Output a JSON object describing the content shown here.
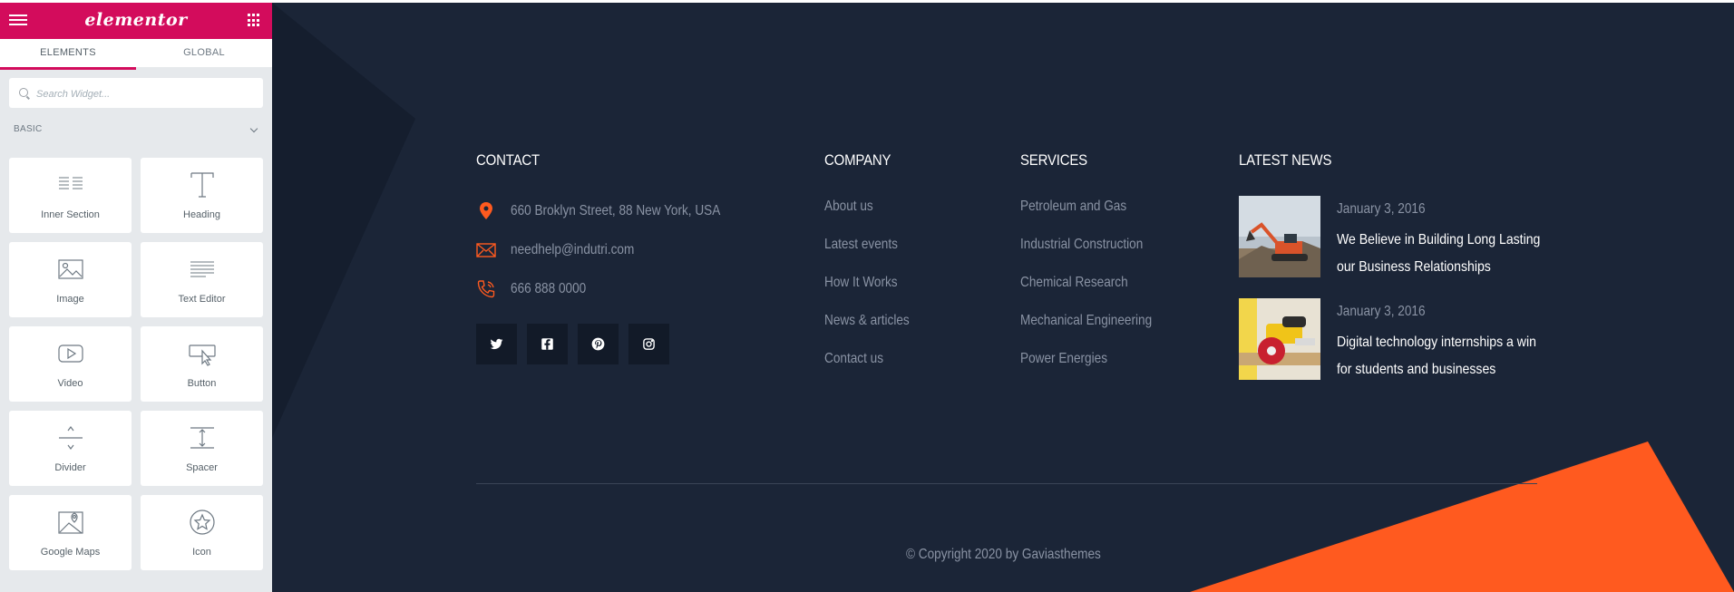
{
  "editor": {
    "brand": "elementor",
    "tabs": [
      {
        "label": "ELEMENTS"
      },
      {
        "label": "GLOBAL"
      }
    ],
    "search": {
      "placeholder": "Search Widget..."
    },
    "category": "BASIC",
    "widgets": [
      {
        "label": "Inner Section",
        "icon": "inner-section-icon"
      },
      {
        "label": "Heading",
        "icon": "heading-icon"
      },
      {
        "label": "Image",
        "icon": "image-icon"
      },
      {
        "label": "Text Editor",
        "icon": "text-editor-icon"
      },
      {
        "label": "Video",
        "icon": "video-icon"
      },
      {
        "label": "Button",
        "icon": "button-icon"
      },
      {
        "label": "Divider",
        "icon": "divider-icon"
      },
      {
        "label": "Spacer",
        "icon": "spacer-icon"
      },
      {
        "label": "Google Maps",
        "icon": "google-maps-icon"
      },
      {
        "label": "Icon",
        "icon": "star-icon"
      }
    ]
  },
  "footer": {
    "colors": {
      "background": "#1b2537",
      "accent": "#ff5a1f",
      "muted": "#8a93a4"
    },
    "contact": {
      "title": "CONTACT",
      "address": "660 Broklyn Street, 88 New York, USA",
      "email": "needhelp@indutri.com",
      "phone": "666 888 0000",
      "social": [
        "twitter-icon",
        "facebook-icon",
        "pinterest-icon",
        "instagram-icon"
      ]
    },
    "company": {
      "title": "COMPANY",
      "links": [
        "About us",
        "Latest events",
        "How It Works",
        "News & articles",
        "Contact us"
      ]
    },
    "services": {
      "title": "SERVICES",
      "links": [
        "Petroleum and Gas",
        "Industrial Construction",
        "Chemical Research",
        "Mechanical Engineering",
        "Power Energies"
      ]
    },
    "news": {
      "title": "LATEST NEWS",
      "items": [
        {
          "date": "January 3, 2016",
          "title": "We Believe in Building Long Lasting our Business Relationships"
        },
        {
          "date": "January 3, 2016",
          "title": "Digital technology internships a win for students and businesses"
        }
      ]
    },
    "copyright": "© Copyright 2020 by Gaviasthemes"
  }
}
